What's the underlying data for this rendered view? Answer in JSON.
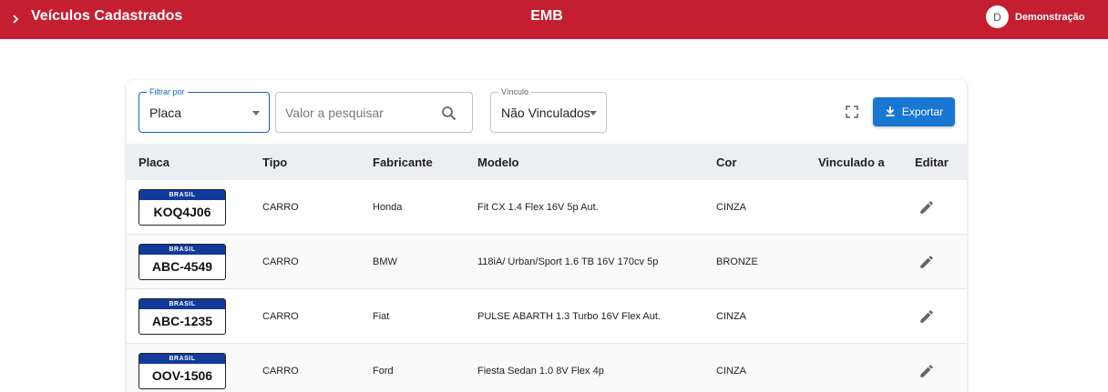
{
  "header": {
    "title": "Veículos Cadastrados",
    "brand": "EMB",
    "avatar_initial": "D",
    "user_name": "Demonstração",
    "bg_color": "#c41f31"
  },
  "filters": {
    "filter_by": {
      "label": "Filtrar por",
      "value": "Placa"
    },
    "search": {
      "placeholder": "Valor a pesquisar",
      "value": ""
    },
    "vinculo": {
      "label": "Vínculo",
      "value": "Não Vinculados"
    },
    "export_label": "Exportar",
    "accent_color": "#1976d2"
  },
  "table": {
    "columns": [
      "Placa",
      "Tipo",
      "Fabricante",
      "Modelo",
      "Cor",
      "Vinculado a",
      "Editar"
    ],
    "plate_band": "BRASIL",
    "rows": [
      {
        "placa": "KOQ4J06",
        "tipo": "CARRO",
        "fabricante": "Honda",
        "modelo": "Fit CX 1.4 Flex 16V 5p Aut.",
        "cor": "CINZA",
        "vinculado": ""
      },
      {
        "placa": "ABC-4549",
        "tipo": "CARRO",
        "fabricante": "BMW",
        "modelo": "118iA/ Urban/Sport 1.6 TB 16V 170cv 5p",
        "cor": "BRONZE",
        "vinculado": ""
      },
      {
        "placa": "ABC-1235",
        "tipo": "CARRO",
        "fabricante": "Fiat",
        "modelo": "PULSE ABARTH 1.3 Turbo 16V Flex Aut.",
        "cor": "CINZA",
        "vinculado": ""
      },
      {
        "placa": "OOV-1506",
        "tipo": "CARRO",
        "fabricante": "Ford",
        "modelo": "Fiesta Sedan 1.0 8V Flex 4p",
        "cor": "CINZA",
        "vinculado": ""
      }
    ]
  }
}
